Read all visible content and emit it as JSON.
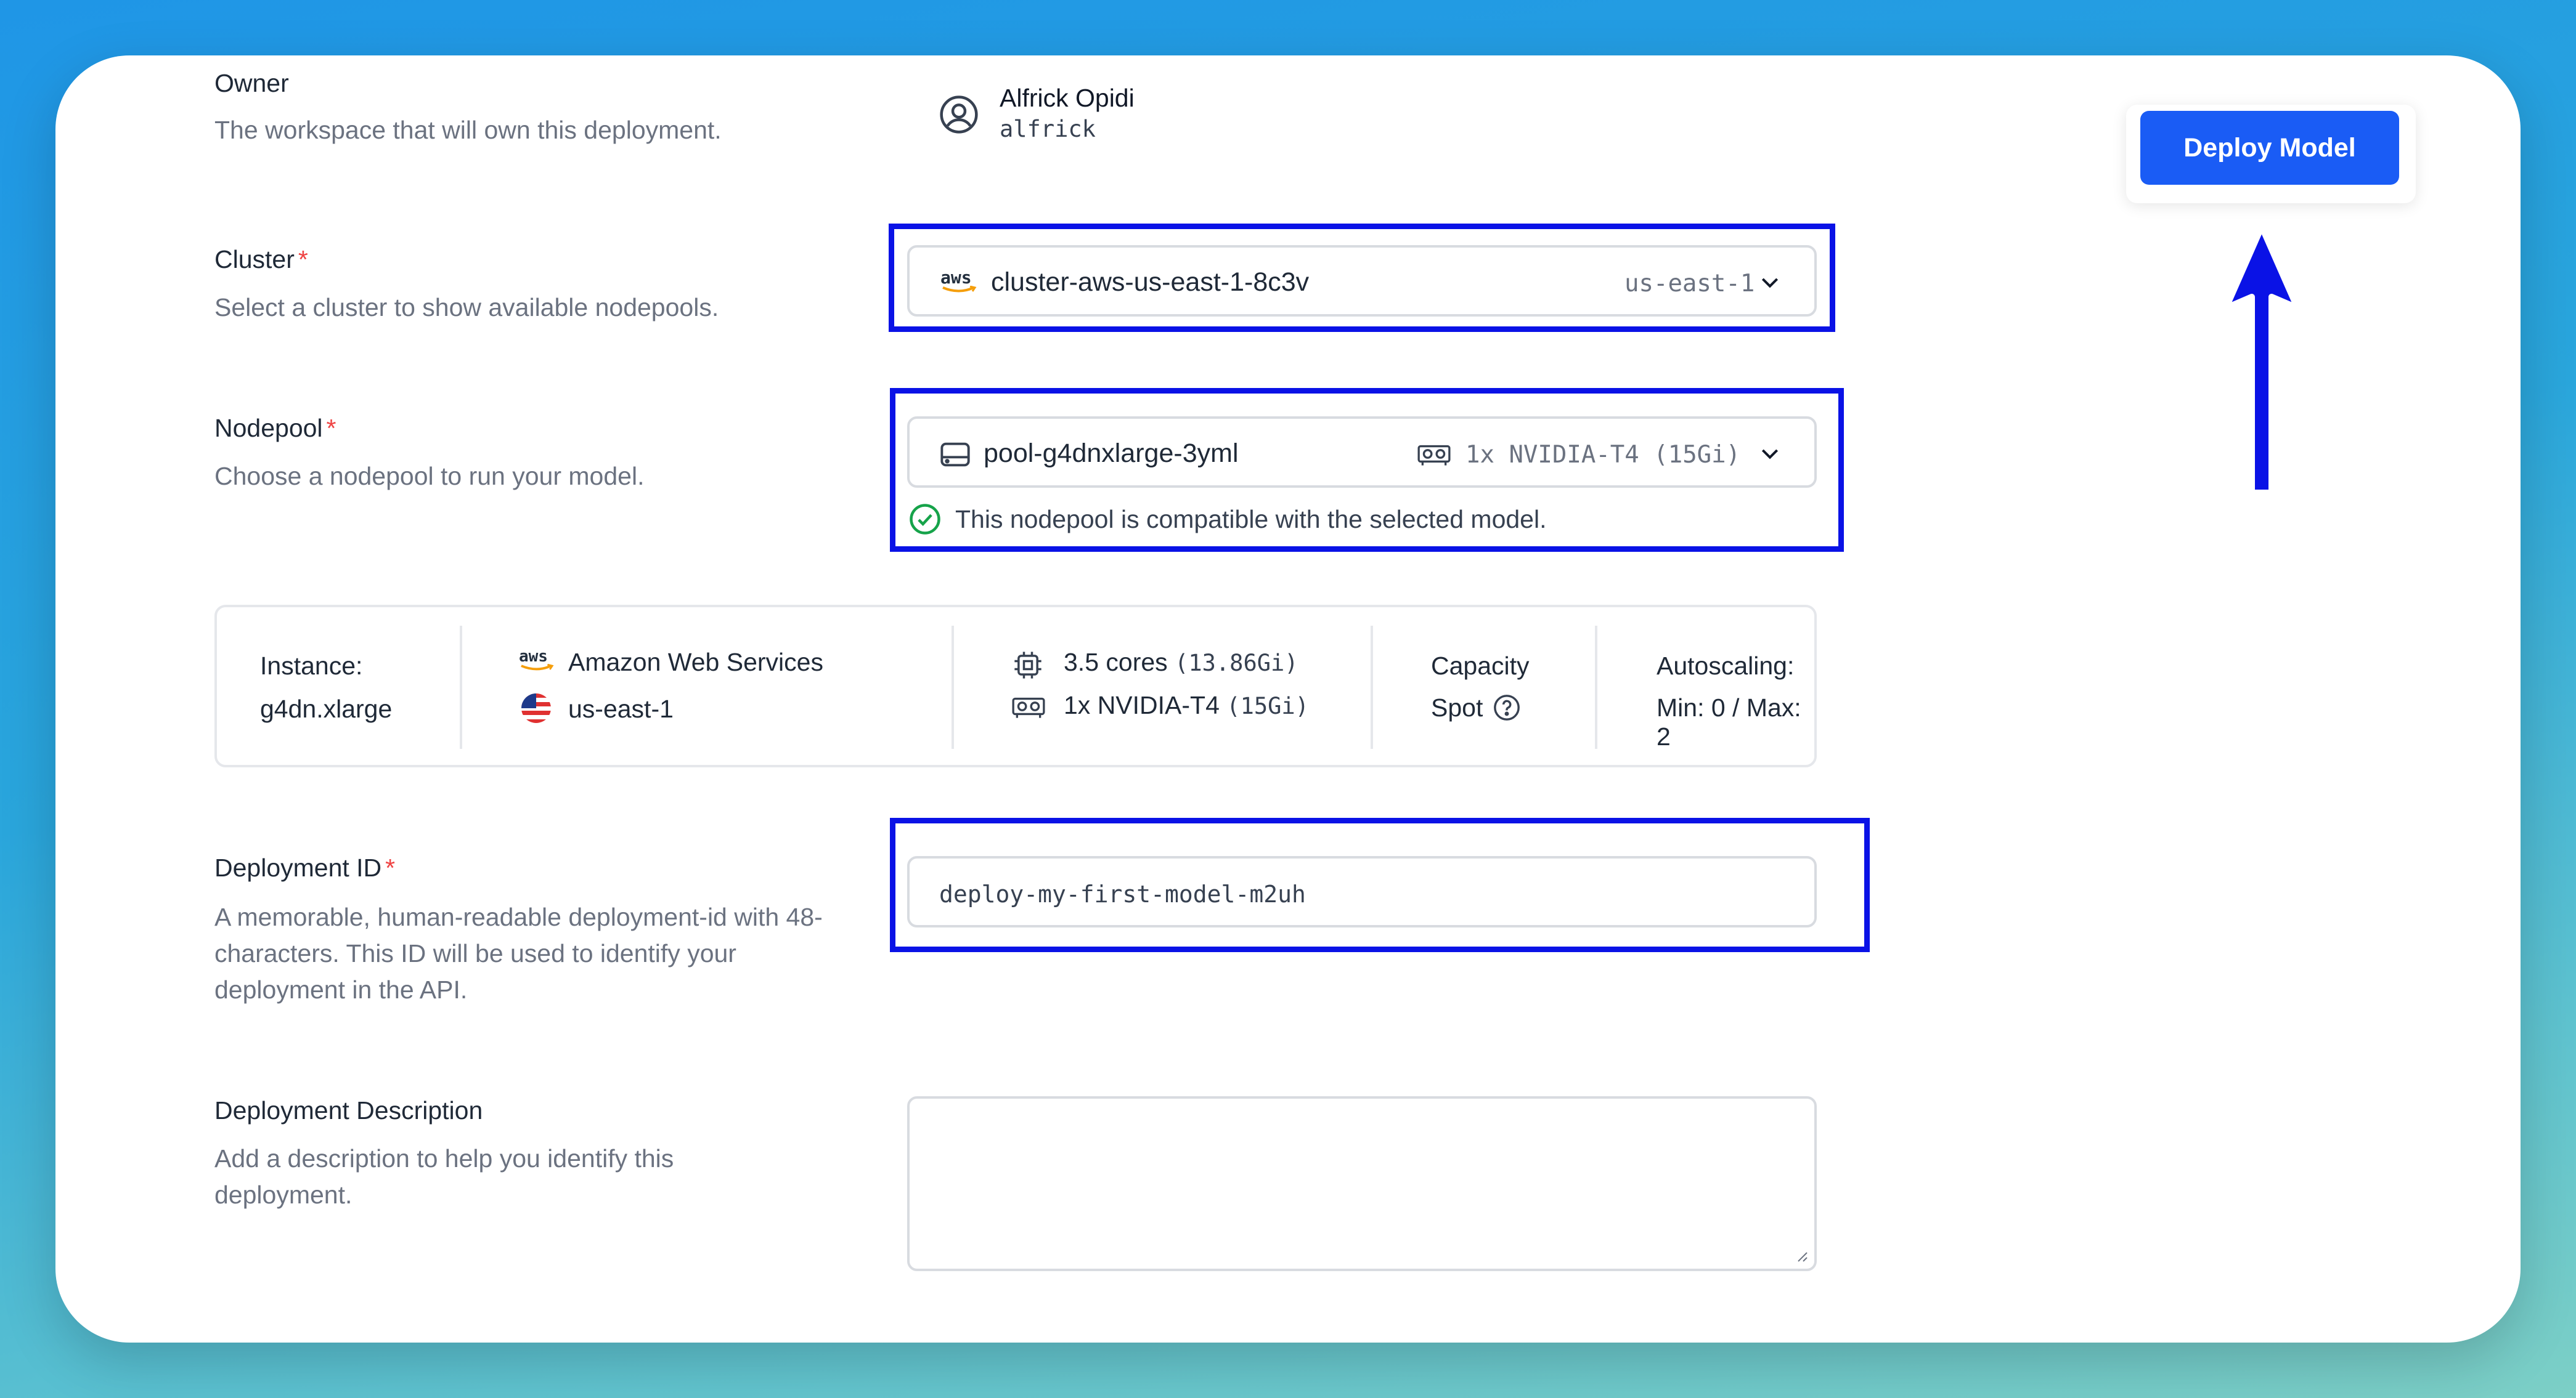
{
  "owner": {
    "label": "Owner",
    "description": "The workspace that will own this deployment.",
    "name": "Alfrick Opidi",
    "username": "alfrick"
  },
  "cluster": {
    "label": "Cluster",
    "required_mark": "*",
    "description": "Select a cluster to show available nodepools.",
    "provider_badge": "aws",
    "value": "cluster-aws-us-east-1-8c3v",
    "region": "us-east-1"
  },
  "nodepool": {
    "label": "Nodepool",
    "required_mark": "*",
    "description": "Choose a nodepool to run your model.",
    "value": "pool-g4dnxlarge-3yml",
    "gpu": "1x NVIDIA-T4 (15Gi)",
    "compat_message": "This nodepool is compatible with the selected model."
  },
  "instance": {
    "instance_label": "Instance:",
    "instance_value": "g4dn.xlarge",
    "provider_badge": "aws",
    "provider": "Amazon Web Services",
    "region": "us-east-1",
    "cpu": "3.5 cores",
    "cpu_mem": "(13.86Gi)",
    "gpu": "1x NVIDIA-T4",
    "gpu_mem": "(15Gi)",
    "capacity_label": "Capacity",
    "capacity_value": "Spot",
    "autoscaling_label": "Autoscaling:",
    "autoscaling_value": "Min: 0 / Max: 2"
  },
  "deployment_id": {
    "label": "Deployment ID",
    "required_mark": "*",
    "description": "A memorable, human-readable deployment-id with 48-characters. This ID will be used to identify your deployment in the API.",
    "value": "deploy-my-first-model-m2uh"
  },
  "deployment_description": {
    "label": "Deployment Description",
    "description": "Add a description to help you identify this deployment.",
    "value": ""
  },
  "actions": {
    "deploy_label": "Deploy Model"
  },
  "colors": {
    "primary": "#1a5cf5",
    "highlight": "#0a12e6",
    "success": "#16a34a",
    "required": "#ef4444"
  },
  "icons": [
    "user-circle-icon",
    "aws-logo-icon",
    "chevron-down-icon",
    "server-icon",
    "gpu-icon",
    "check-circle-icon",
    "cpu-icon",
    "us-flag-icon",
    "help-circle-icon",
    "arrow-up-icon"
  ]
}
